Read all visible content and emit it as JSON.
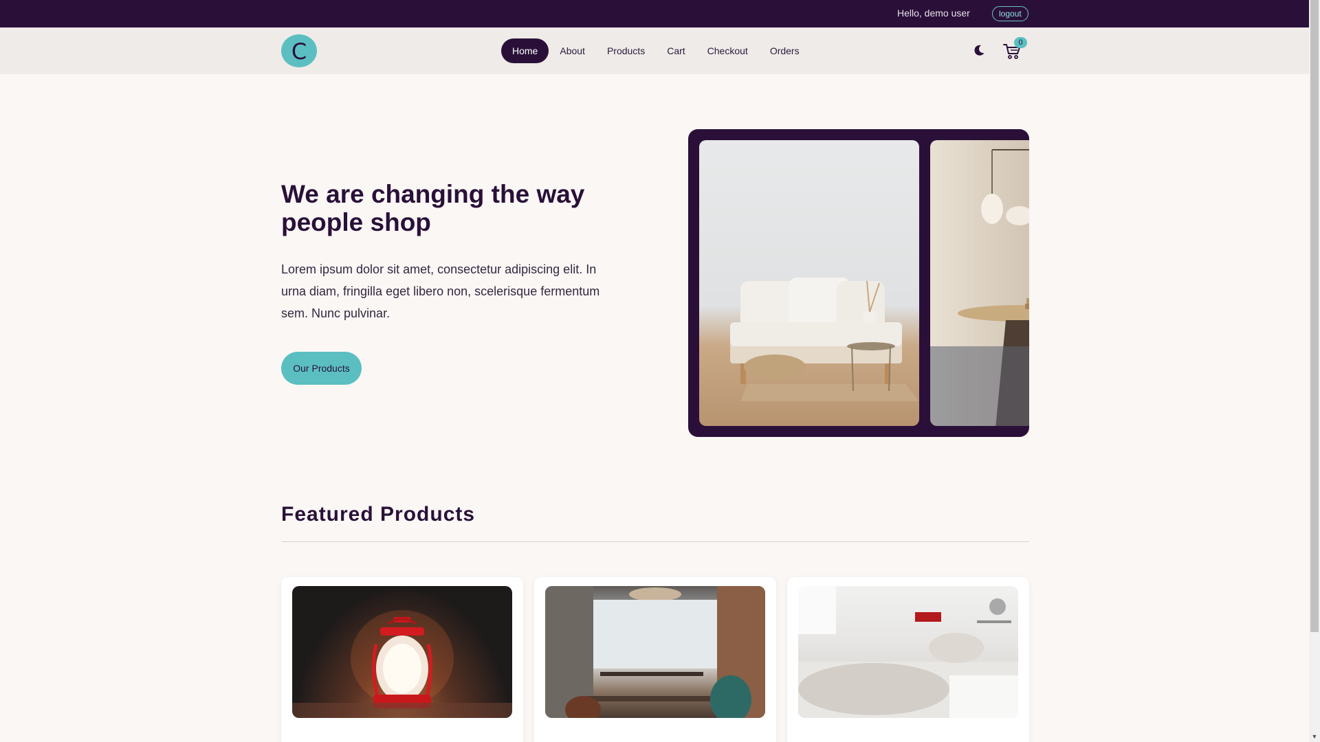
{
  "topbar": {
    "greeting": "Hello, demo user",
    "logout_label": "logout"
  },
  "nav": {
    "logo_letter": "C",
    "links": [
      "Home",
      "About",
      "Products",
      "Cart",
      "Checkout",
      "Orders"
    ],
    "active": "Home",
    "cart_count": "0",
    "theme_icon": "moon-icon",
    "cart_icon": "cart-icon"
  },
  "hero": {
    "title": "We are changing the way people shop",
    "text": "Lorem ipsum dolor sit amet, consectetur adipiscing elit. In urna diam, fringilla eget libero non, scelerisque fermentum sem. Nunc pulvinar.",
    "button_label": "Our Products"
  },
  "featured": {
    "title": "Featured Products"
  },
  "colors": {
    "primary": "#2a1038",
    "accent": "#5bbfc1",
    "background": "#faf7f5"
  }
}
